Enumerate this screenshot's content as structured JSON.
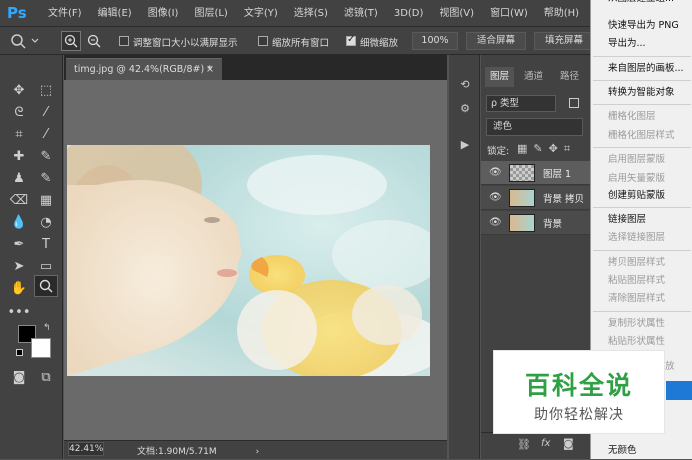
{
  "app": {
    "logo": "Ps"
  },
  "menubar": {
    "items": [
      "文件(F)",
      "编辑(E)",
      "图像(I)",
      "图层(L)",
      "文字(Y)",
      "选择(S)",
      "滤镜(T)",
      "3D(D)",
      "视图(V)",
      "窗口(W)",
      "帮助(H)"
    ]
  },
  "options": {
    "fit_window_label": "调整窗口大小以满屏显示",
    "fit_window_checked": false,
    "zoom_all_label": "缩放所有窗口",
    "zoom_all_checked": false,
    "scrubby_label": "细微缩放",
    "scrubby_checked": true,
    "zoom_100": "100%",
    "fit_screen": "适合屏幕",
    "fill_screen": "填充屏幕"
  },
  "document": {
    "tab_title": "timg.jpg @ 42.4%(RGB/8#) *",
    "close_glyph": "×",
    "zoom": "42.41%",
    "status": "文档:1.90M/5.71M",
    "status_arrow": "›"
  },
  "layers_panel": {
    "tabs": [
      "图层",
      "通道",
      "路径"
    ],
    "kind_filter": "ρ 类型",
    "blend_mode": "滤色",
    "lock_label": "锁定:",
    "layers": [
      {
        "name": "图层 1",
        "selected": true
      },
      {
        "name": "背景 拷贝",
        "selected": false
      },
      {
        "name": "背景",
        "selected": false
      }
    ],
    "footer_icons": [
      "link-icon",
      "fx-icon",
      "mask-icon"
    ]
  },
  "context_menu": {
    "items": [
      {
        "label": "从图层建立组...",
        "disabled": false
      },
      {
        "label": "快速导出为 PNG",
        "disabled": false
      },
      {
        "label": "导出为...",
        "disabled": false
      },
      {
        "label": "来自图层的画板...",
        "disabled": false
      },
      {
        "label": "转换为智能对象",
        "disabled": false
      },
      {
        "label": "栅格化图层",
        "disabled": true
      },
      {
        "label": "栅格化图层样式",
        "disabled": true
      },
      {
        "label": "启用图层蒙版",
        "disabled": true
      },
      {
        "label": "启用矢量蒙版",
        "disabled": true
      },
      {
        "label": "创建剪贴蒙版",
        "disabled": false
      },
      {
        "label": "链接图层",
        "disabled": false
      },
      {
        "label": "选择链接图层",
        "disabled": true
      },
      {
        "label": "拷贝图层样式",
        "disabled": true
      },
      {
        "label": "粘贴图层样式",
        "disabled": true
      },
      {
        "label": "清除图层样式",
        "disabled": true
      },
      {
        "label": "复制形状属性",
        "disabled": true
      },
      {
        "label": "粘贴形状属性",
        "disabled": true
      },
      {
        "label": "从隔离图层释放",
        "disabled": true
      },
      {
        "label": "无颜色",
        "disabled": false
      }
    ]
  },
  "watermark": {
    "title": "百科全说",
    "subtitle": "助你轻松解决"
  }
}
